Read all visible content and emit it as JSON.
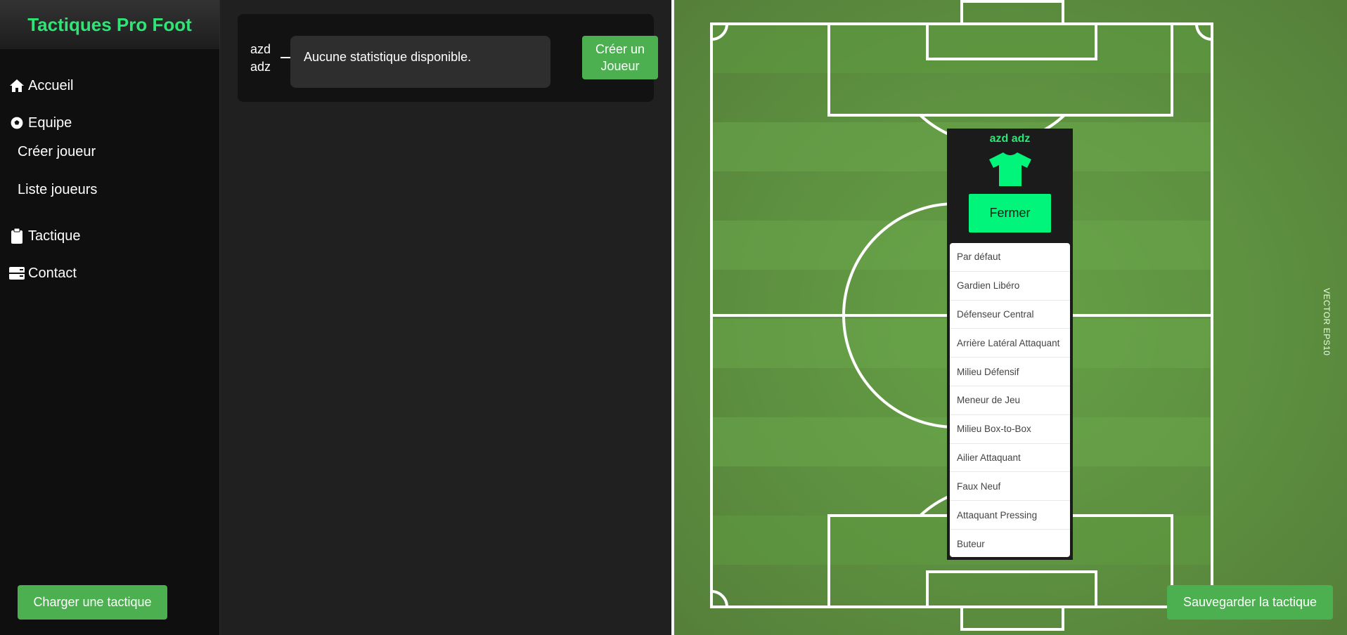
{
  "app": {
    "title": "Tactiques Pro Foot"
  },
  "sidebar": {
    "items": [
      {
        "label": "Accueil",
        "icon": "home-icon"
      },
      {
        "label": "Equipe",
        "icon": "soccer-ball-icon"
      },
      {
        "label": "Créer joueur"
      },
      {
        "label": "Liste joueurs"
      },
      {
        "label": "Tactique",
        "icon": "clipboard-icon"
      },
      {
        "label": "Contact",
        "icon": "contact-card-icon"
      }
    ],
    "load_button": "Charger une tactique"
  },
  "player_card": {
    "first_name": "azd",
    "last_name": "adz",
    "stats_text": "Aucune statistique disponible.",
    "create_button_line1": "Créer un",
    "create_button_line2": "Joueur"
  },
  "popup": {
    "player_name": "azd adz",
    "close_button": "Fermer",
    "roles": [
      "Par défaut",
      "Gardien Libéro",
      "Défenseur Central",
      "Arrière Latéral Attaquant",
      "Milieu Défensif",
      "Meneur de Jeu",
      "Milieu Box-to-Box",
      "Ailier Attaquant",
      "Faux Neuf",
      "Attaquant Pressing",
      "Buteur"
    ]
  },
  "pitch": {
    "watermark": "VECTOR EPS10"
  },
  "save_button": "Sauvegarder la tactique",
  "colors": {
    "accent": "#2ee576",
    "button": "#4caf50",
    "popup_accent": "#00f57a"
  }
}
